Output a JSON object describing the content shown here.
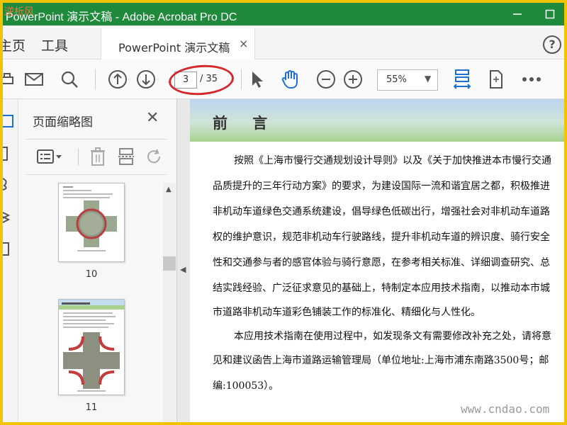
{
  "window": {
    "title": "PowerPoint 演示文稿 - Adobe Acrobat Pro DC",
    "logo_overlay": "逆析风"
  },
  "nav": {
    "home_tab": "主页",
    "tools_tab": "工具",
    "doc_tab": "PowerPoint 演示文稿",
    "close_glyph": "×",
    "help_glyph": "?"
  },
  "toolbar": {
    "current_page": "3",
    "total_pages": "/ 35",
    "zoom": "55%"
  },
  "thumbnails_panel": {
    "title": "页面缩略图",
    "close_glyph": "✕",
    "pages": [
      {
        "number": "10"
      },
      {
        "number": "11"
      }
    ]
  },
  "document": {
    "heading": "前 言",
    "lines": [
      "按照《上海市慢行交通规划设计导则》以及《关于加快推进本市慢行交通",
      "品质提升的三年行动方案》的要求，为建设国际一流和谐宜居之都，积极推进",
      "非机动车道绿色交通系统建设，倡导绿色低碳出行，增强社会对非机动车道路",
      "权的维护意识，规范非机动车行驶路线，提升非机动车道的辨识度、骑行安全",
      "性和交通参与者的感官体验与骑行意愿，在参考相关标准、详细调查研究、总",
      "结实践经验、广泛征求意见的基础上，特制定本应用技术指南，以推动本市城",
      "市道路非机动车道彩色铺装工作的标准化、精细化与人性化。",
      "本应用技术指南在使用过程中，如发现条文有需要修改补充之处，请将意",
      "见和建议函告上海市道路运输管理局（单位地址:上海市浦东南路3500号；邮",
      "编:100053）。"
    ]
  },
  "watermark": "www.cndao.com",
  "colors": {
    "titlebar": "#1f8a3c",
    "frame_border": "#f0c400",
    "annotation_ellipse": "#d6272b",
    "hand_tool": "#1f6fd1"
  }
}
